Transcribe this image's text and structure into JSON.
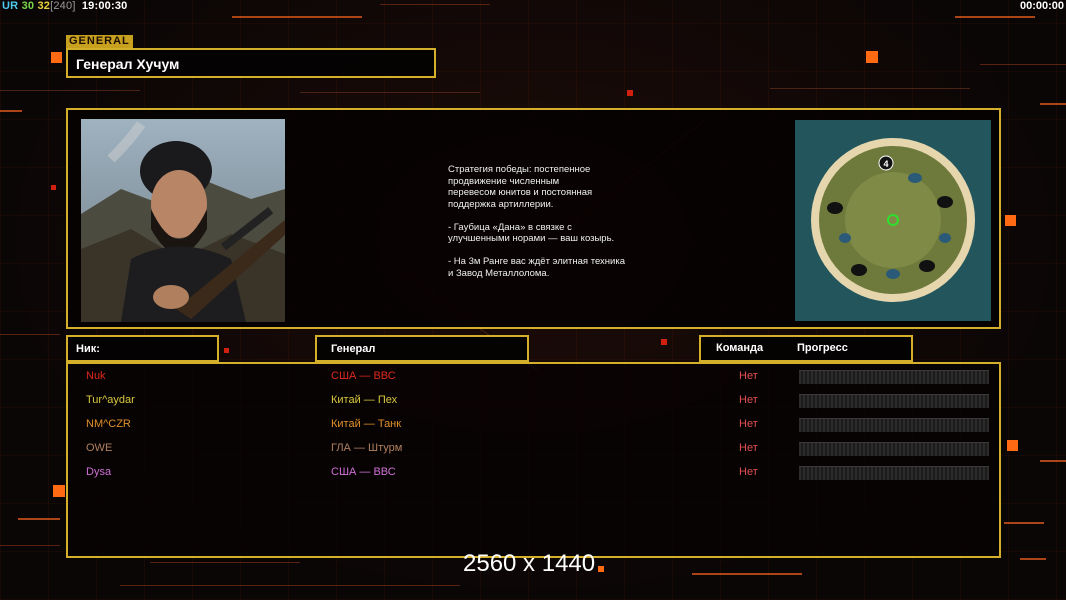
{
  "hud": {
    "ur_label": "UR",
    "value1": "30",
    "value2": "32",
    "bracket_value": "[240]",
    "clock": "19:00:30",
    "timer_right": "00:00:00"
  },
  "header": {
    "tag": "GENERAL",
    "title": "Генерал Хучум"
  },
  "general_info": {
    "description": "Стратегия победы: постепенное\nпродвижение численным\nперевесом юнитов и постоянная\nподдержка артиллерии.\n\n- Гаубица «Дана» в связке с\nулучшенными норами — ваш козырь.\n\n- На 3м Ранге вас ждёт элитная техника\nи Завод Металлолома.",
    "map_marker": "4"
  },
  "columns": {
    "nick": "Ник:",
    "general": "Генерал",
    "team": "Команда",
    "progress": "Прогресс"
  },
  "players": [
    {
      "nick": "Nuk",
      "faction": "США — ВВС",
      "team": "Нет",
      "progress": 0,
      "nick_color": "#e0281e",
      "faction_color": "#e0281e"
    },
    {
      "nick": "Tur^aydar",
      "faction": "Китай — Пех",
      "team": "Нет",
      "progress": 0,
      "nick_color": "#d8c840",
      "faction_color": "#d8c840"
    },
    {
      "nick": "NM^CZR",
      "faction": "Китай — Танк",
      "team": "Нет",
      "progress": 0,
      "nick_color": "#e0902a",
      "faction_color": "#e0902a"
    },
    {
      "nick": "OWE",
      "faction": "ГЛА — Штурм",
      "team": "Нет",
      "progress": 0,
      "nick_color": "#b08060",
      "faction_color": "#b08060"
    },
    {
      "nick": "Dysa",
      "faction": "США — ВВС",
      "team": "Нет",
      "progress": 0,
      "nick_color": "#d070d8",
      "faction_color": "#d070d8"
    }
  ],
  "team_color": "#e05050",
  "resolution_text": "2560 x 1440"
}
